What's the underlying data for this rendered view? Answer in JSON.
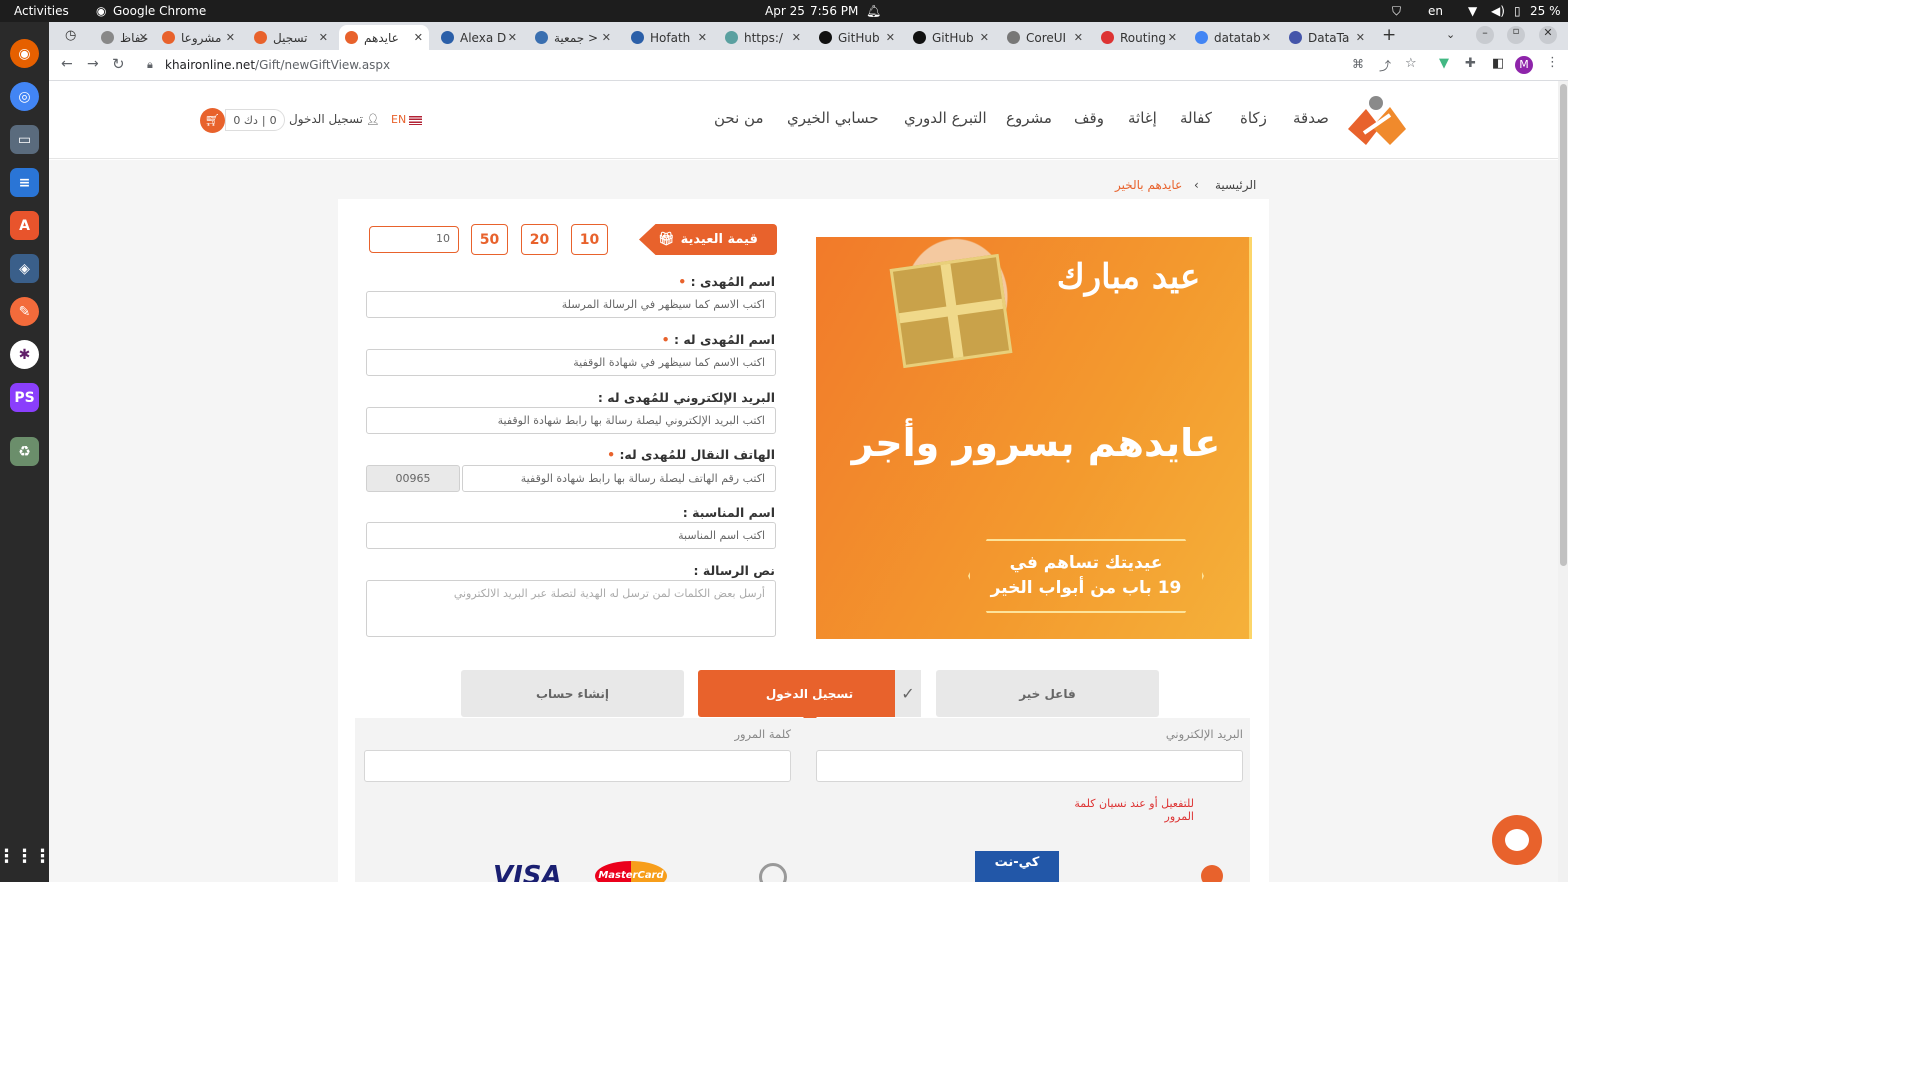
{
  "os": {
    "activities": "Activities",
    "app_name": "Google Chrome",
    "date": "Apr 25",
    "time": "7:56 PM",
    "lang": "en",
    "battery": "25 %"
  },
  "tabs": [
    {
      "label": "حفاظ",
      "color": "#888"
    },
    {
      "label": "مشروعا",
      "color": "#e8622c"
    },
    {
      "label": "تسجيل",
      "color": "#e8622c"
    },
    {
      "label": "عايدهم",
      "color": "#e8622c"
    },
    {
      "label": "Alexa D",
      "color": "#2b5fa8"
    },
    {
      "label": "جمعية >",
      "color": "#3a6fb0"
    },
    {
      "label": "Hofath",
      "color": "#2b5fa8"
    },
    {
      "label": "https:/",
      "color": "#5aa0a0"
    },
    {
      "label": "GitHub",
      "color": "#111"
    },
    {
      "label": "GitHub",
      "color": "#111"
    },
    {
      "label": "CoreUI",
      "color": "#777"
    },
    {
      "label": "Routing",
      "color": "#d33"
    },
    {
      "label": "datatab",
      "color": "#4285f4"
    },
    {
      "label": "DataTa",
      "color": "#4455aa"
    }
  ],
  "address": {
    "host": "khaironline.net",
    "path": "/Gift/newGiftView.aspx"
  },
  "profile_initial": "M",
  "header": {
    "nav": [
      "صدقة",
      "زكاة",
      "كفالة",
      "إغاثة",
      "وقف",
      "مشروع",
      "التبرع الدوري",
      "حسابي الخيري",
      "من نحن"
    ],
    "lang_switch": "EN",
    "login": "تسجيل الدخول",
    "cart_count": "0",
    "cart_amount": "0 دك"
  },
  "breadcrumb": {
    "home": "الرئيسية",
    "current": "عايدهم بالخير"
  },
  "gift_form": {
    "amount_label": "قيمة العيدية",
    "amount_options": [
      "10",
      "20",
      "50"
    ],
    "custom_amount": "10",
    "sender_label": "اسم المُهدى :",
    "sender_placeholder": "اكتب الاسم كما سيظهر في الرسالة المرسلة",
    "recipient_label": "اسم المُهدى له :",
    "recipient_placeholder": "اكتب الاسم كما سيظهر في شهادة الوقفية",
    "email_label": "البريد الإلكتروني للمُهدى له :",
    "email_placeholder": "اكتب البريد الإلكتروني ليصلة رسالة بها رابط شهادة الوقفية",
    "phone_label": "الهاتف النقال للمُهدى له:",
    "phone_placeholder": "اكتب رقم الهاتف ليصلة رسالة بها رابط شهادة الوقفية",
    "phone_code": "00965",
    "occasion_label": "اسم المناسبة :",
    "occasion_placeholder": "اكتب اسم المناسبة",
    "message_label": "نص الرسالة :",
    "message_placeholder": "أرسل بعض الكلمات لمن ترسل له الهدية لتصلة عبر البريد الالكتروني"
  },
  "banner": {
    "eid": "عيد مبارك",
    "headline": "عايدهم بسرور وأجر",
    "sub1": "عيديتك تساهم في",
    "sub2": "19 باب من أبواب الخير"
  },
  "steps": {
    "guest": "فاعل خير",
    "login": "تسجيل الدخول",
    "register": "إنشاء حساب"
  },
  "login": {
    "email_label": "البريد الإلكتروني",
    "password_label": "كلمة المرور",
    "forgot": "للتفعيل أو عند نسيان كلمة المرور"
  },
  "payment": {
    "visa": "VISA",
    "mastercard": "MasterCard",
    "knet": "كي-نت"
  },
  "colors": {
    "brand": "#e8622c",
    "banner": "#f08a2c"
  }
}
